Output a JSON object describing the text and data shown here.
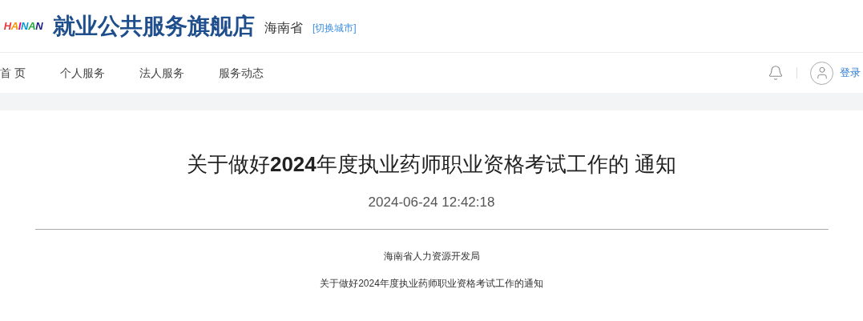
{
  "header": {
    "logo": "HAINAN",
    "site_title": "就业公共服务旗舰店",
    "province": "海南省",
    "switch_city": "[切换城市]"
  },
  "nav": {
    "items": [
      {
        "label": "首 页",
        "selected": false
      },
      {
        "label": "个人服务",
        "selected": false
      },
      {
        "label": "法人服务",
        "selected": false
      },
      {
        "label": "服务动态",
        "selected": false
      }
    ],
    "login": "登录"
  },
  "article": {
    "title": "关于做好**2024**年度执业药师职业资格考试工作的 通知",
    "date": "2024-06-24 12:42:18",
    "paragraphs": [
      "海南省人力资源开发局",
      "关于做好2024年度执业药师职业资格考试工作的通知"
    ]
  }
}
